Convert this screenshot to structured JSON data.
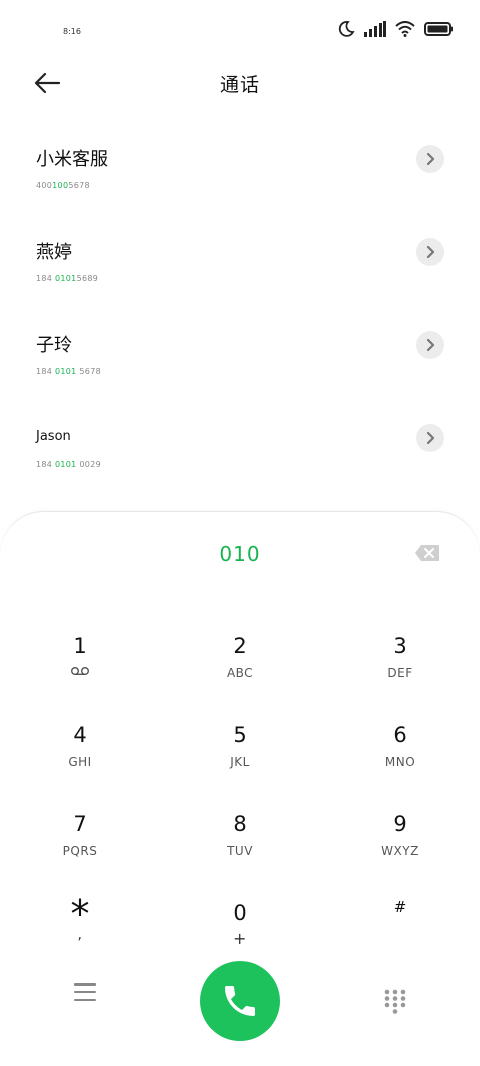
{
  "status_bar": {
    "time": "8:16",
    "icons": [
      "moon-icon",
      "signal-icon",
      "wifi-icon",
      "battery-icon"
    ]
  },
  "header": {
    "title": "通话",
    "back_icon": "arrow-left-icon"
  },
  "contacts": [
    {
      "name": "小米客服",
      "number_prefix": "400",
      "number_match": "100",
      "number_suffix": "5678"
    },
    {
      "name": "燕婷",
      "number_prefix": "184 ",
      "number_match": "0101",
      "number_suffix": "5689"
    },
    {
      "name": "子玲",
      "number_prefix": "184 ",
      "number_match": "0101",
      "number_suffix": " 5678"
    },
    {
      "name": "Jason",
      "number_prefix": "184 ",
      "number_match": "0101",
      "number_suffix": " 0029"
    }
  ],
  "dialer": {
    "input": "010",
    "delete_icon": "backspace-icon",
    "keys": [
      {
        "digit": "1",
        "letters": ""
      },
      {
        "digit": "2",
        "letters": "ABC"
      },
      {
        "digit": "3",
        "letters": "DEF"
      },
      {
        "digit": "4",
        "letters": "GHI"
      },
      {
        "digit": "5",
        "letters": "JKL"
      },
      {
        "digit": "6",
        "letters": "MNO"
      },
      {
        "digit": "7",
        "letters": "PQRS"
      },
      {
        "digit": "8",
        "letters": "TUV"
      },
      {
        "digit": "9",
        "letters": "WXYZ"
      },
      {
        "digit": "*",
        "letters": ","
      },
      {
        "digit": "0",
        "letters": "+"
      },
      {
        "digit": "#",
        "letters": ""
      }
    ]
  },
  "bottom_bar": {
    "menu_icon": "menu-icon",
    "call_icon": "phone-icon",
    "keypad_icon": "dialpad-icon"
  },
  "colors": {
    "accent_green": "#17b450",
    "call_button": "#1ec25d",
    "chevron_bg": "#ececec"
  }
}
